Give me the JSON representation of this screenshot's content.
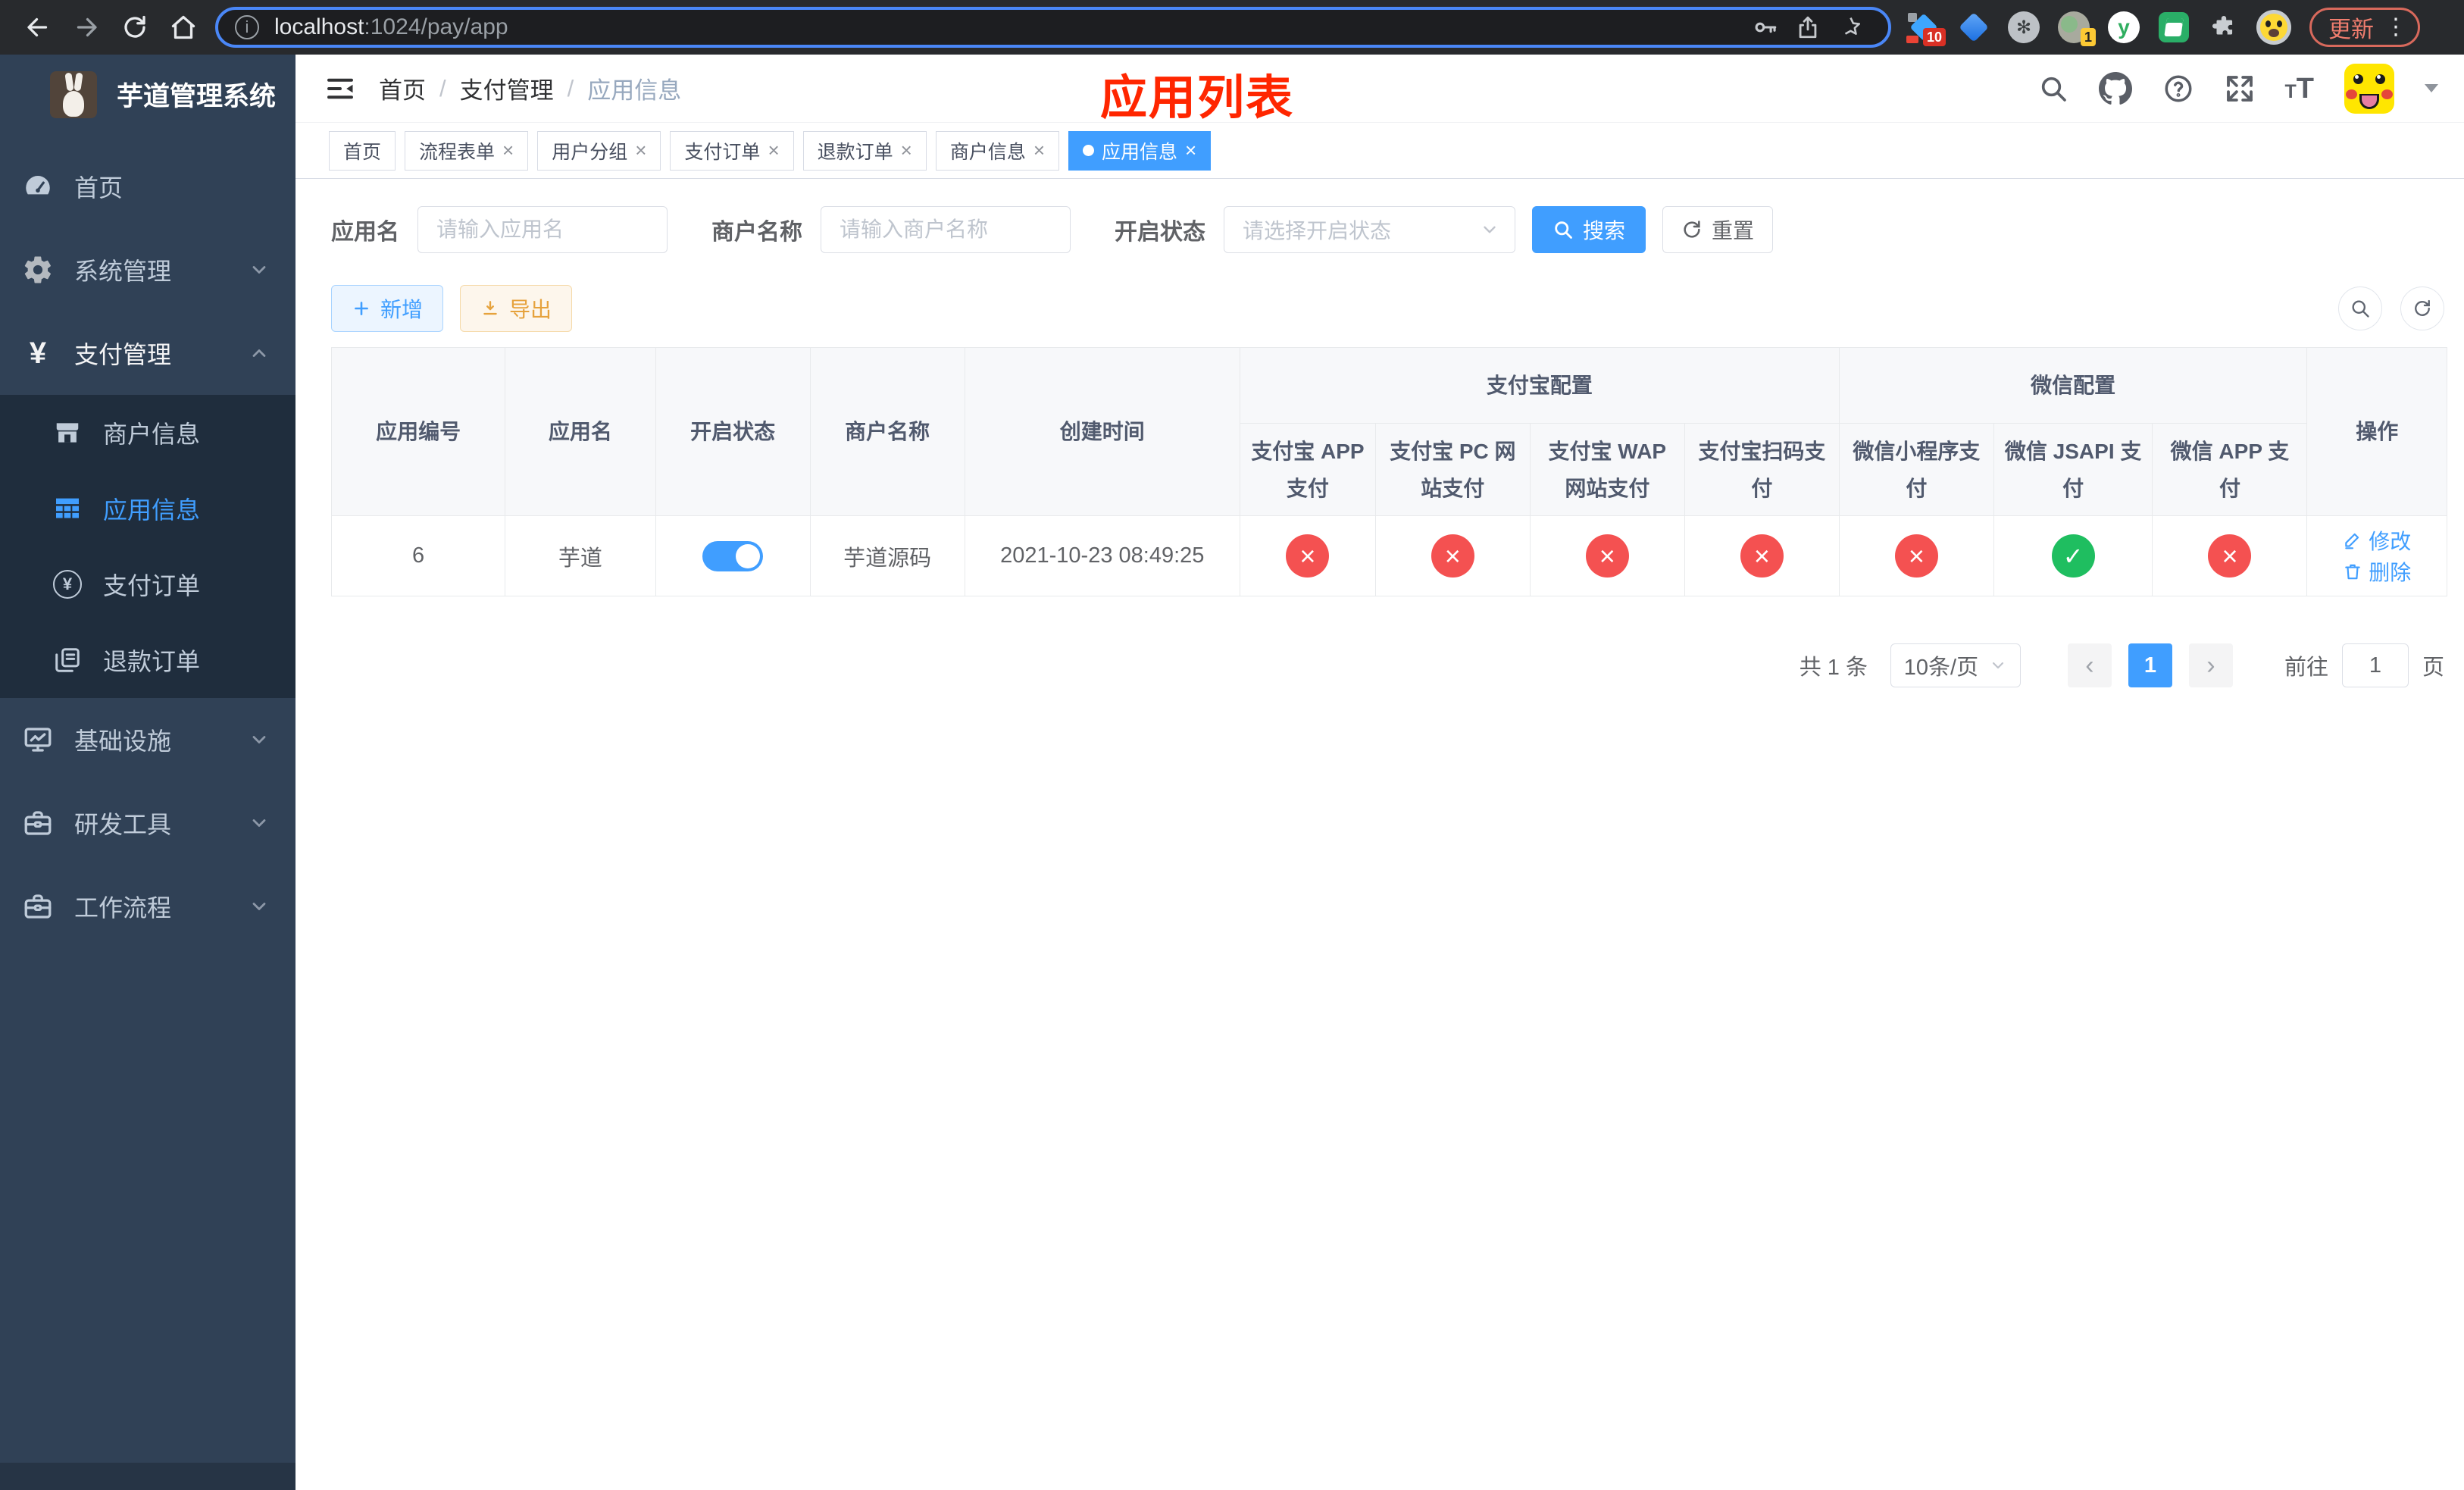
{
  "browser": {
    "url_host": "localhost",
    "url_path": ":1024/pay/app",
    "update_label": "更新",
    "menu_dots": "⋮",
    "ext_badge_blue_diamond": "10",
    "ext_badge_green_circle": "1"
  },
  "sidebar": {
    "title": "芋道管理系统",
    "menu": [
      {
        "label": "首页"
      },
      {
        "label": "系统管理"
      },
      {
        "label": "支付管理"
      },
      {
        "label": "基础设施"
      },
      {
        "label": "研发工具"
      },
      {
        "label": "工作流程"
      }
    ],
    "submenu": [
      {
        "label": "商户信息"
      },
      {
        "label": "应用信息"
      },
      {
        "label": "支付订单"
      },
      {
        "label": "退款订单"
      }
    ]
  },
  "navbar": {
    "breadcrumb": [
      "首页",
      "支付管理",
      "应用信息"
    ],
    "separator": "/",
    "annotation": "应用列表"
  },
  "tabs": [
    {
      "label": "首页"
    },
    {
      "label": "流程表单"
    },
    {
      "label": "用户分组"
    },
    {
      "label": "支付订单"
    },
    {
      "label": "退款订单"
    },
    {
      "label": "商户信息"
    },
    {
      "label": "应用信息"
    }
  ],
  "filter": {
    "app_name_label": "应用名",
    "app_name_placeholder": "请输入应用名",
    "merchant_label": "商户名称",
    "merchant_placeholder": "请输入商户名称",
    "status_label": "开启状态",
    "status_placeholder": "请选择开启状态",
    "search_label": "搜索",
    "reset_label": "重置"
  },
  "toolbar": {
    "add_label": "新增",
    "export_label": "导出"
  },
  "table": {
    "columns": {
      "app_id": "应用编号",
      "app_name": "应用名",
      "status": "开启状态",
      "merchant": "商户名称",
      "created": "创建时间",
      "alipay_group": "支付宝配置",
      "wechat_group": "微信配置",
      "alipay": [
        "支付宝 APP 支付",
        "支付宝 PC 网站支付",
        "支付宝 WAP 网站支付",
        "支付宝扫码支付"
      ],
      "wechat": [
        "微信小程序支付",
        "微信 JSAPI 支付",
        "微信 APP 支付"
      ],
      "ops": "操作"
    },
    "row": {
      "app_id": "6",
      "app_name": "芋道",
      "enabled": true,
      "merchant": "芋道源码",
      "created": "2021-10-23 08:49:25",
      "configs": [
        false,
        false,
        false,
        false,
        false,
        true,
        false
      ],
      "edit_label": "修改",
      "delete_label": "删除"
    }
  },
  "pagination": {
    "total": "共 1 条",
    "page_size": "10条/页",
    "prev": "‹",
    "next": "›",
    "current_page": "1",
    "goto_label": "前往",
    "goto_value": "1",
    "page_suffix": "页"
  },
  "colors": {
    "primary": "#409eff",
    "danger": "#f45151",
    "success": "#1fbe60",
    "warning": "#e6a23c",
    "annotation_red": "#ff2600",
    "sidebar_bg": "#304156",
    "submenu_bg": "#1f2d3d"
  }
}
